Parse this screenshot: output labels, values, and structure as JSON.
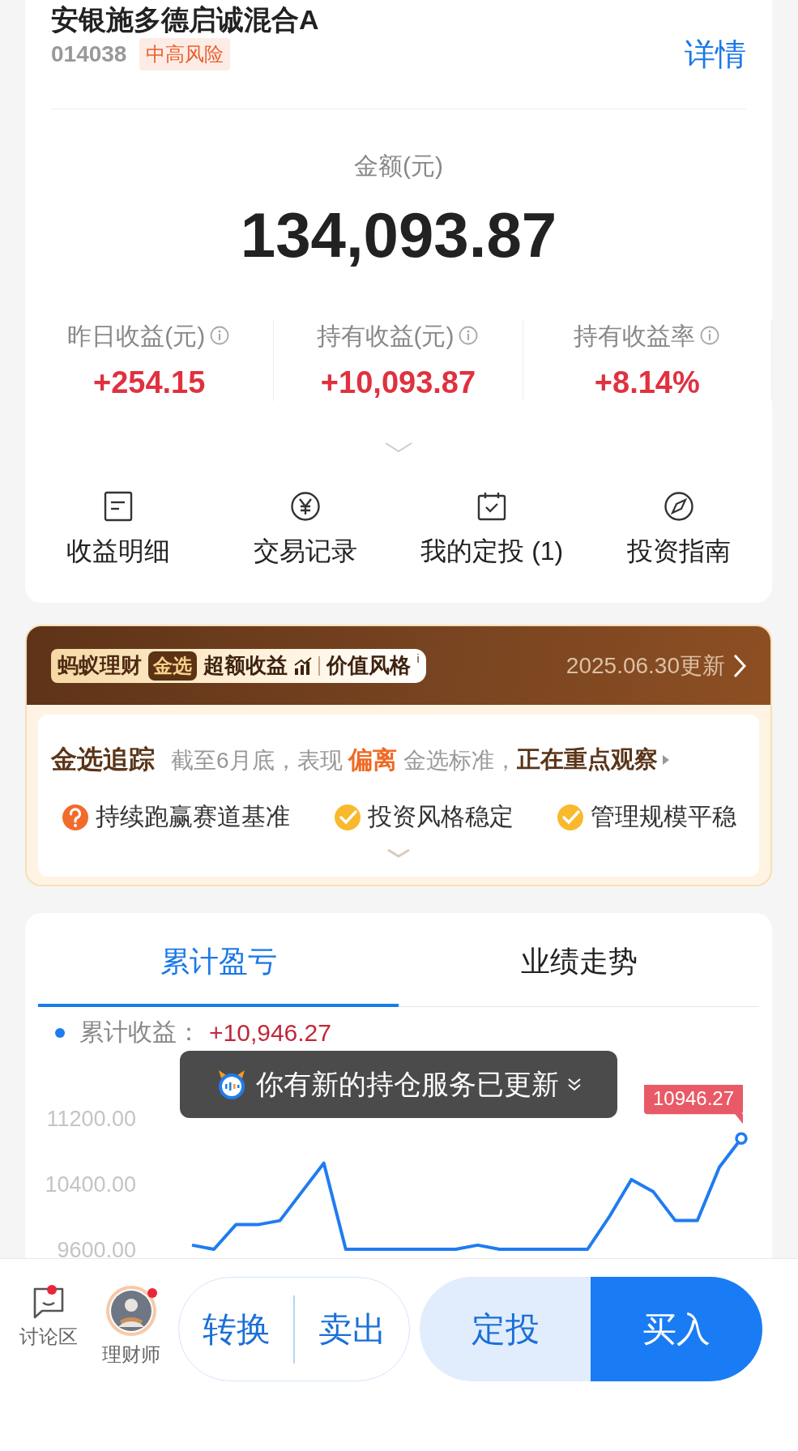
{
  "fund": {
    "title": "安银施多德启诚混合A",
    "code": "014038",
    "risk_tag": "中高风险",
    "detail_link": "详情"
  },
  "amount": {
    "label": "金额(元)",
    "value": "134,093.87"
  },
  "stats": [
    {
      "label": "昨日收益(元)",
      "value": "+254.15"
    },
    {
      "label": "持有收益(元)",
      "value": "+10,093.87"
    },
    {
      "label": "持有收益率",
      "value": "+8.14%"
    }
  ],
  "shortcuts": [
    {
      "label": "收益明细"
    },
    {
      "label": "交易记录"
    },
    {
      "label": "我的定投 (1)"
    },
    {
      "label": "投资指南"
    }
  ],
  "gold_select": {
    "brand": "蚂蚁理财",
    "badge": "金选",
    "tag_1": "超额收益",
    "tag_2": "价值风格",
    "info_mark": "i",
    "updated": "2025.06.30更新",
    "tracking": {
      "title": "金选追踪",
      "text": "截至6月底，表现 **偏离** 金选标准，",
      "status": "正在重点观察"
    },
    "criteria": [
      {
        "label": "持续跑赢赛道基准",
        "met": false
      },
      {
        "label": "投资风格稳定",
        "met": true
      },
      {
        "label": "管理规模平稳",
        "met": true
      }
    ]
  },
  "chart_tabs": [
    {
      "label": "累计盈亏",
      "selected": true
    },
    {
      "label": "业绩走势",
      "selected": false
    }
  ],
  "legend": {
    "label": "累计收益：",
    "value": "+10,946.27"
  },
  "toast": {
    "text": "你有新的持仓服务已更新"
  },
  "chart_data": {
    "type": "line",
    "ylim": [
      9600,
      11200
    ],
    "categories": [
      null,
      null,
      null,
      null,
      null,
      null,
      null,
      null,
      null,
      null,
      null,
      null,
      null,
      null,
      null,
      null,
      null,
      null,
      null,
      null,
      null,
      null,
      null,
      null,
      null,
      null
    ],
    "yticks": [
      {
        "value": 9600,
        "label": "9600.00"
      },
      {
        "value": 10400,
        "label": "10400.00"
      },
      {
        "value": 11200,
        "label": "11200.00"
      }
    ],
    "series": [
      {
        "color": "#1f7cf0",
        "values": [
          9650,
          9600,
          9900,
          9900,
          9950,
          10300,
          10650,
          9600,
          null,
          null,
          null,
          null,
          9600,
          9650,
          9600,
          null,
          null,
          null,
          9600,
          10000,
          10450,
          10300,
          9950,
          9950,
          10600,
          10950
        ]
      }
    ],
    "annotations": [
      {
        "text": "10946.27"
      }
    ]
  },
  "bottom_bar": {
    "discuss": {
      "label": "讨论区",
      "unread": true
    },
    "advisor": {
      "label": "理财师",
      "unread": true
    },
    "buttons": [
      "转换",
      "卖出",
      "定投",
      "买入"
    ]
  }
}
